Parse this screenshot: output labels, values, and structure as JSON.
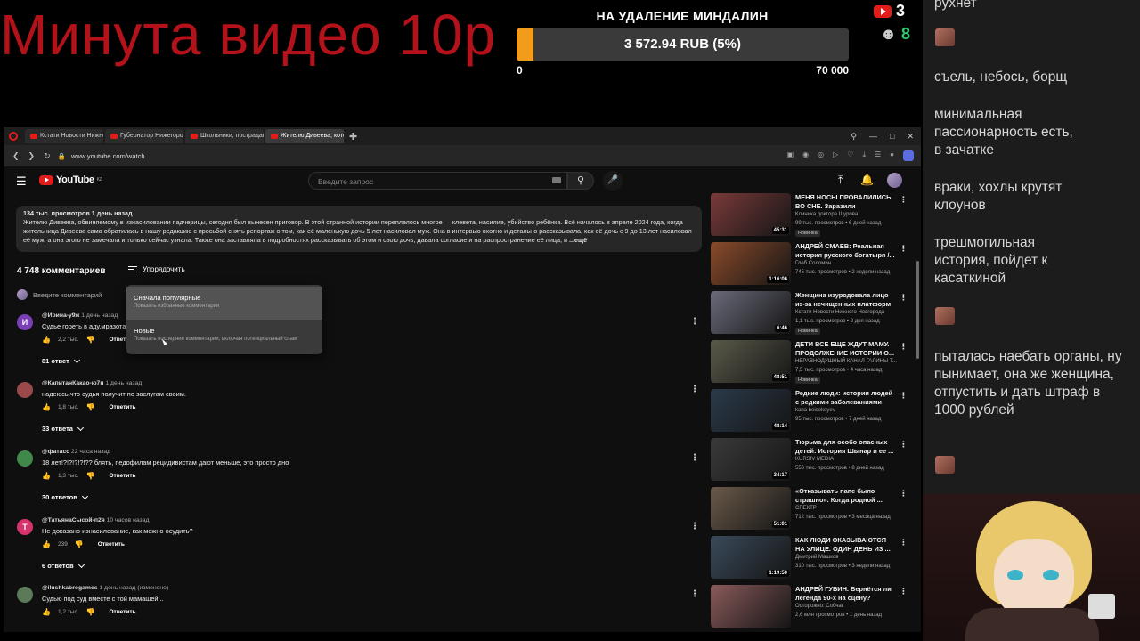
{
  "overlay": {
    "promo_text": "Минута видео 10р",
    "goal_title": "НА УДАЛЕНИЕ МИНДАЛИН",
    "goal_amount": "3 572.94 RUB (5%)",
    "goal_progress_fraction": 0.05,
    "goal_min": "0",
    "goal_max": "70 000",
    "youtube_viewers": "3",
    "viewers_count": "8",
    "colors": {
      "promo": "#b3121a",
      "goal_fill": "#f39b1b",
      "viewers": "#2ecc71"
    }
  },
  "chat": {
    "messages": [
      "рухнет",
      "съель, небось, борщ",
      "минимальная пассионарность есть, в зачатке",
      "враки, хохлы крутят клоунов",
      "трешмогильная история, пойдет к касаткиной",
      "пыталась наебать органы, ну пынимает, она же женщина, отпустить и дать штраф в 1000 рублей"
    ]
  },
  "browser": {
    "tabs": [
      "Кстати Новости Нижнего",
      "Губернатор Нижегородс",
      "Школьники, пострадавш",
      "Жителю Дивеева, котор"
    ],
    "url": "www.youtube.com/watch"
  },
  "youtube": {
    "logo_text": "YouTube",
    "logo_region": "KZ",
    "search_placeholder": "Введите запрос",
    "description": {
      "stats": "134 тыс. просмотров  1 день назад",
      "text": "Жителю Дивеева, обвиняемому в изнасиловании падчерицы, сегодня был вынесен приговор. В этой странной истории переплелось многое — клевета, насилие, убийство ребёнка. Всё началось в апреле 2024 года, когда жительница Дивеева сама обратилась в нашу редакцию с просьбой снять репортаж о том, как её маленькую дочь 5 лет насиловал муж. Она в интервью охотно и детально рассказывала, как её дочь с 9 до 13 лет насиловал её муж, а она этого не замечала и только сейчас узнала. Также она заставляла в подробностях рассказывать об этом и свою дочь, давала согласие и на распространение её лица, и",
      "more": "...ещё"
    },
    "comments_count": "4 748 комментариев",
    "sort_label": "Упорядочить",
    "add_comment_placeholder": "Введите комментарий",
    "sort_menu": [
      {
        "label": "Сначала популярные",
        "sub": "Показать избранные комментарии"
      },
      {
        "label": "Новые",
        "sub": "Показать последние комментарии, включая потенциальный спам"
      }
    ],
    "comments": [
      {
        "avatar": "И",
        "author": "@Ирина-у9ж",
        "time": "1 день назад",
        "text": "Судье гореть в аду,мразота",
        "likes": "2,2 тыс.",
        "reply": "Ответить",
        "replies": "81 ответ",
        "color": "#7b3fb5"
      },
      {
        "avatar": "",
        "author": "@КапитанКакао-ю7п",
        "time": "1 день назад",
        "text": "надеюсь,что судья получит по заслугам своим.",
        "likes": "1,8 тыс.",
        "reply": "Ответить",
        "replies": "33 ответа",
        "color": "#9a4a4a"
      },
      {
        "avatar": "",
        "author": "@фатасс",
        "time": "22 часа назад",
        "text": "18 лет!?!?!?!?!?? блять, педофилам рецидивистам дают меньше, это просто дно",
        "likes": "1,3 тыс.",
        "reply": "Ответить",
        "replies": "30 ответов",
        "color": "#3f8a4a"
      },
      {
        "avatar": "Т",
        "author": "@ТатьянаСысой-п2я",
        "time": "10 часов назад",
        "text": "Не доказано изнасилование, как можно осудить?",
        "likes": "239",
        "reply": "Ответить",
        "replies": "6 ответов",
        "color": "#d6336c"
      },
      {
        "avatar": "",
        "author": "@ilushkabrogames",
        "time": "1 день назад (изменено)",
        "text": "Судью под суд вместе с той мамашей...",
        "likes": "1,2 тыс.",
        "reply": "Ответить",
        "replies": "",
        "color": "#5a7a5a"
      }
    ],
    "recommendations": [
      {
        "title": "МЕНЯ НОСЫ ПРОВАЛИЛИСЬ ВО СНЕ. Заразили Сифилисом. \"Сама...",
        "channel": "Клиника доктора Шурова",
        "meta": "99 тыс. просмотров • 6 дней назад",
        "badge": "Новинка",
        "duration": "45:31",
        "thumb": "#7a3a3a"
      },
      {
        "title": "АНДРЕЙ СМАЕВ: Реальная история русского богатыря /...",
        "channel": "Глеб Соломин",
        "meta": "745 тыс. просмотров • 2 недели назад",
        "badge": "",
        "duration": "1:16:06",
        "thumb": "#8a4a2a"
      },
      {
        "title": "Женщина изуродовала лицо из-за нечищенных платформ ...",
        "channel": "Кстати Новости Нижнего Новгорода",
        "meta": "1,1 тыс. просмотров • 2 дня назад",
        "badge": "Новинка",
        "duration": "6:46",
        "thumb": "#6a6a7a"
      },
      {
        "title": "ДЕТИ ВСЕ ЕЩЕ ЖДУТ МАМУ. ПРОДОЛЖЕНИЕ ИСТОРИИ О...",
        "channel": "НЕРАВНОДУШНЫЙ КАНАЛ ГАЛИНЫ Т...",
        "meta": "7,5 тыс. просмотров • 4 часа назад",
        "badge": "Новинка",
        "duration": "48:51",
        "thumb": "#5a5a4a"
      },
      {
        "title": "Редкие люди: истории людей с редкими заболеваниями",
        "channel": "kana beisekeyev",
        "meta": "95 тыс. просмотров • 7 дней назад",
        "badge": "",
        "duration": "48:14",
        "thumb": "#2a3a4a"
      },
      {
        "title": "Тюрьма для особо опасных детей: История Шынар и ее ...",
        "channel": "KURSIV MEDIA",
        "meta": "556 тыс. просмотров • 8 дней назад",
        "badge": "",
        "duration": "34:17",
        "thumb": "#3a3a3a"
      },
      {
        "title": "«Отказывать папе было страшно». Когда родной ...",
        "channel": "СПЕКТР",
        "meta": "712 тыс. просмотров • 3 месяца назад",
        "badge": "",
        "duration": "51:01",
        "thumb": "#6a5a4a"
      },
      {
        "title": "КАК ЛЮДИ ОКАЗЫВАЮТСЯ НА УЛИЦЕ. ОДИН ДЕНЬ ИЗ ...",
        "channel": "Дмитрий Машков",
        "meta": "310 тыс. просмотров • 3 недели назад",
        "badge": "",
        "duration": "1:19:50",
        "thumb": "#3a4a5a"
      },
      {
        "title": "АНДРЕЙ ГУБИН. Вернётся ли легенда 90-х на сцену?",
        "channel": "Осторожно: Собчак",
        "meta": "2,6 млн просмотров • 1 день назад",
        "badge": "",
        "duration": "",
        "thumb": "#8a5a5a"
      }
    ]
  }
}
